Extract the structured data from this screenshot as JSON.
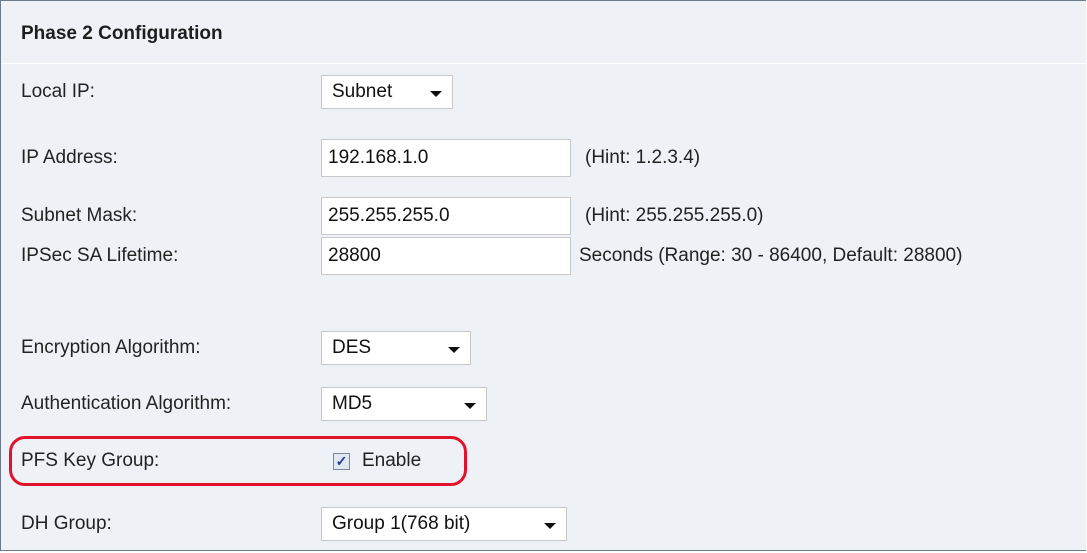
{
  "section": {
    "title": "Phase 2 Configuration"
  },
  "fields": {
    "local_ip": {
      "label": "Local IP:",
      "value": "Subnet"
    },
    "ip_address": {
      "label": "IP Address:",
      "value": "192.168.1.0",
      "hint": "(Hint: 1.2.3.4)"
    },
    "subnet_mask": {
      "label": "Subnet Mask:",
      "value": "255.255.255.0",
      "hint": "(Hint: 255.255.255.0)"
    },
    "ipsec_lifetime": {
      "label": "IPSec SA Lifetime:",
      "value": "28800",
      "hint": "Seconds  (Range: 30 - 86400, Default: 28800)"
    },
    "encryption": {
      "label": "Encryption Algorithm:",
      "value": "DES"
    },
    "authentication": {
      "label": "Authentication Algorithm:",
      "value": "MD5"
    },
    "pfs": {
      "label": "PFS Key Group:",
      "checkbox_label": "Enable",
      "checked": true
    },
    "dh_group": {
      "label": "DH Group:",
      "value": "Group 1(768 bit)"
    }
  },
  "colors": {
    "highlight_ring": "#e3122c",
    "panel_bg": "#eef2f6"
  },
  "icons": {
    "dropdown": "caret-down-icon",
    "check": "checkmark-icon"
  }
}
